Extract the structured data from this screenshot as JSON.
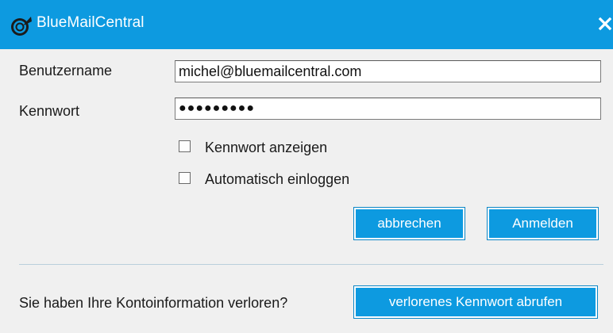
{
  "window": {
    "title": "BlueMailCentral",
    "icon": "bluemail-logo-icon",
    "close_icon": "close-icon"
  },
  "form": {
    "username_label": "Benutzername",
    "username_value": "michel@bluemailcentral.com",
    "password_label": "Kennwort",
    "password_masked": "●●●●●●●●●",
    "show_password_label": "Kennwort anzeigen",
    "show_password_checked": false,
    "auto_login_label": "Automatisch einloggen",
    "auto_login_checked": false
  },
  "buttons": {
    "cancel": "abbrechen",
    "login": "Anmelden",
    "recover": "verlorenes Kennwort abrufen"
  },
  "footer": {
    "lost_info_text": "Sie haben Ihre Kontoinformation verloren?"
  },
  "colors": {
    "accent": "#0d9ae0",
    "background": "#f0f0f0"
  }
}
